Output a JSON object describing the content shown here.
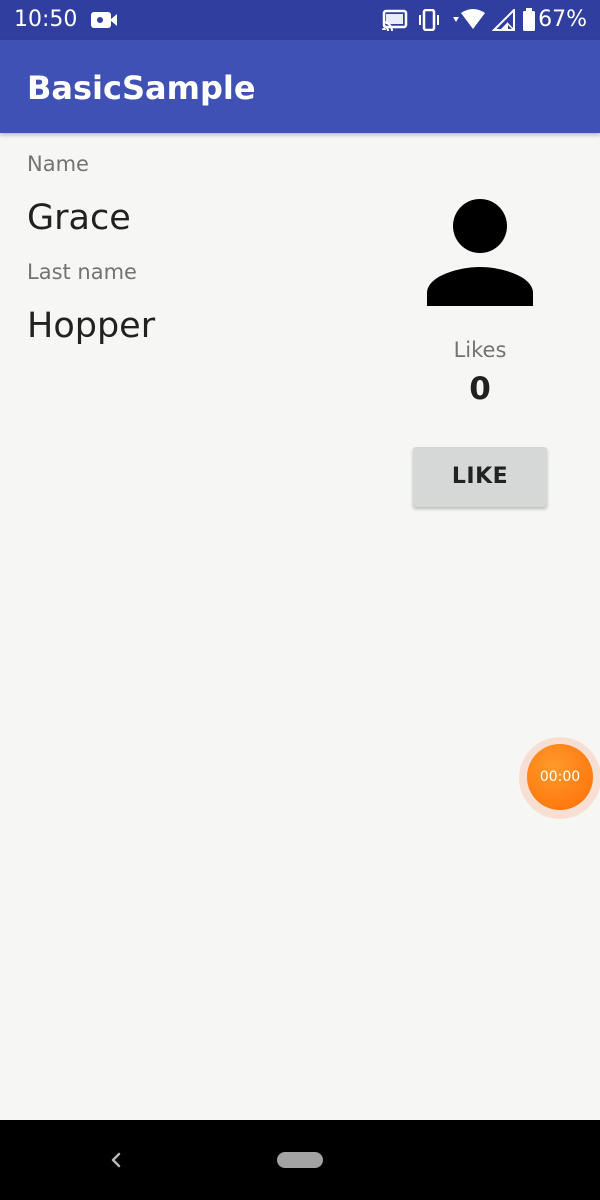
{
  "status_bar": {
    "time": "10:50",
    "battery_percent": "67%",
    "icons": [
      "video-camera-icon",
      "cast-icon",
      "vibrate-icon",
      "wifi-icon",
      "signal-icon",
      "battery-icon"
    ]
  },
  "app_bar": {
    "title": "BasicSample",
    "color": "#3f51b5"
  },
  "profile": {
    "name_label": "Name",
    "name_value": "Grace",
    "last_name_label": "Last name",
    "last_name_value": "Hopper",
    "avatar_icon": "person-icon"
  },
  "likes": {
    "label": "Likes",
    "count": "0",
    "button_label": "LIKE"
  },
  "recorder": {
    "timer": "00:00",
    "color": "#ff7a10"
  },
  "nav_bar": {
    "icons": [
      "back-icon",
      "home-pill-icon"
    ]
  }
}
